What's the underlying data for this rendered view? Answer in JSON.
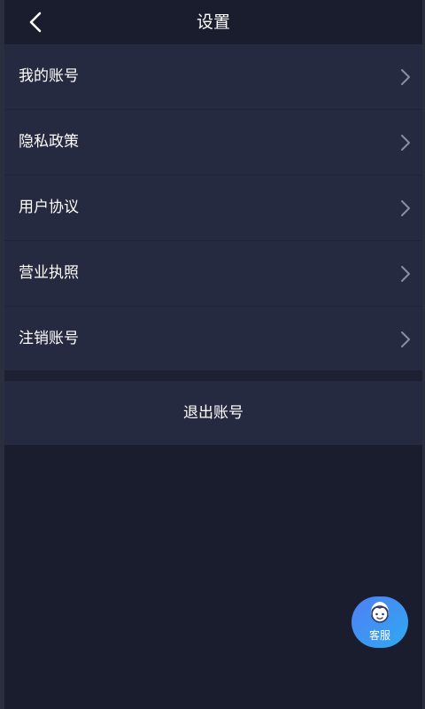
{
  "header": {
    "title": "设置",
    "back_icon": "chevron-left-icon"
  },
  "settings": {
    "items": [
      {
        "label": "我的账号",
        "icon": "chevron-right-icon"
      },
      {
        "label": "隐私政策",
        "icon": "chevron-right-icon"
      },
      {
        "label": "用户协议",
        "icon": "chevron-right-icon"
      },
      {
        "label": "营业执照",
        "icon": "chevron-right-icon"
      },
      {
        "label": "注销账号",
        "icon": "chevron-right-icon"
      }
    ]
  },
  "logout": {
    "label": "退出账号"
  },
  "customer_service": {
    "label": "客服",
    "icon": "agent-avatar-icon"
  },
  "colors": {
    "background": "#1a1d2e",
    "row_background": "#262a40",
    "text": "#ffffff",
    "chevron": "#8a8ea0",
    "service_gradient_start": "#4f7ff5",
    "service_gradient_end": "#2fa9f0"
  }
}
